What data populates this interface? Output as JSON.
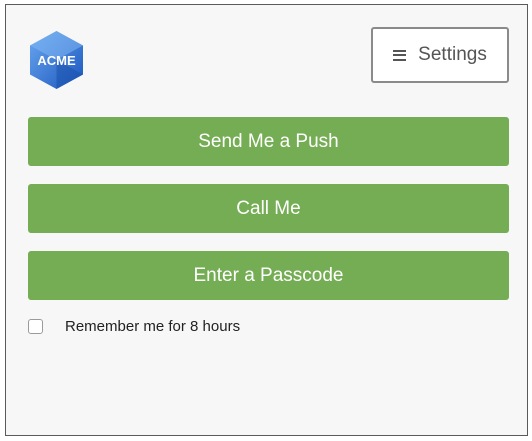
{
  "logo": {
    "text": "ACME",
    "icon": "acme-logo-icon",
    "colors": {
      "light": "#5a9ae6",
      "dark": "#1f5fc4",
      "text": "#ffffff"
    }
  },
  "settings": {
    "label": "Settings",
    "icon": "hamburger-menu-icon"
  },
  "actions": {
    "push_label": "Send Me a Push",
    "call_label": "Call Me",
    "passcode_label": "Enter a Passcode"
  },
  "remember": {
    "label": "Remember me for 8 hours",
    "checked": false
  },
  "colors": {
    "primary_button": "#75ad54",
    "button_text": "#ffffff",
    "panel_background": "#f7f7f7",
    "frame_border": "#5a5a5a"
  }
}
